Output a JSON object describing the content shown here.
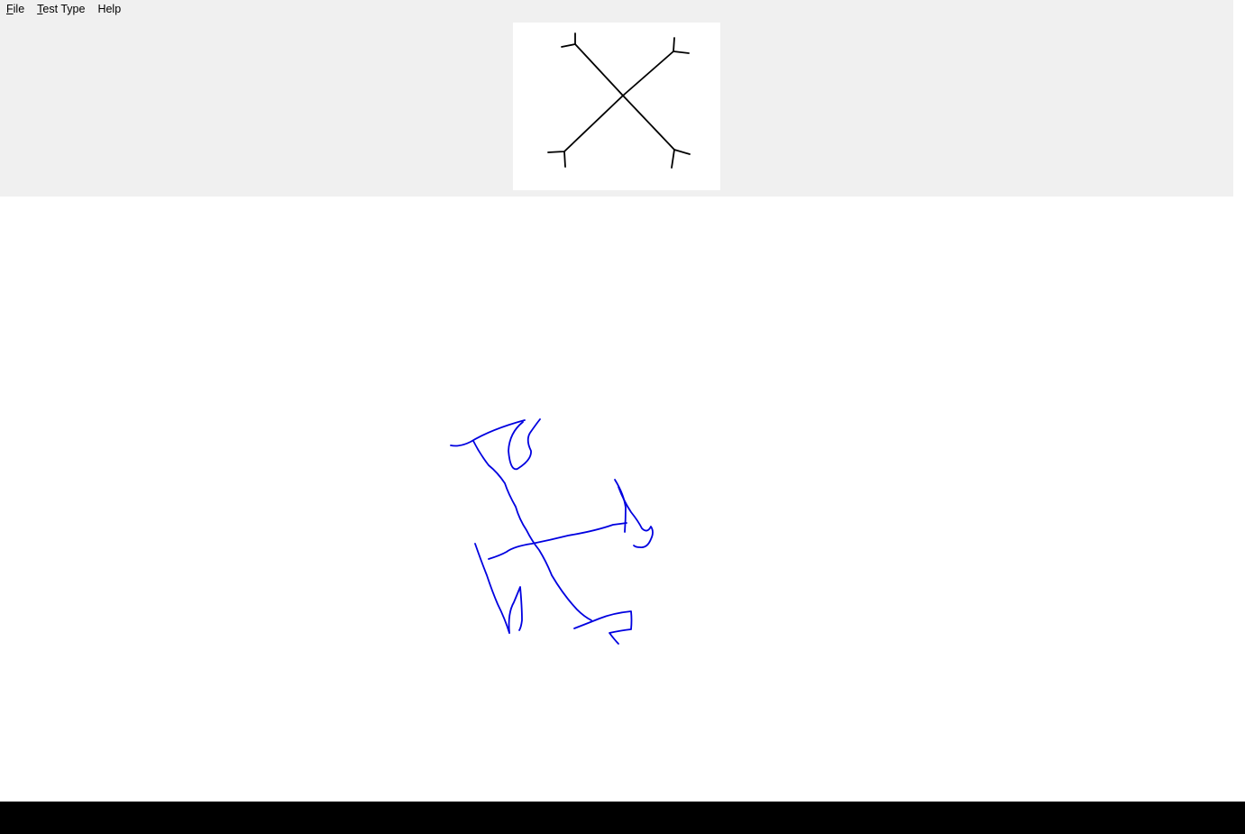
{
  "menubar": {
    "items": [
      {
        "label": "File",
        "mnemonic": "F",
        "rest": "ile"
      },
      {
        "label": "Test Type",
        "mnemonic": "T",
        "rest": "est Type"
      },
      {
        "label": "Help",
        "mnemonic": "",
        "rest": "Help"
      }
    ]
  },
  "reference_figure": {
    "description_icon": "x-cross-reference-icon",
    "stroke_color": "#000000"
  },
  "drawing": {
    "ink_color": "#0000e0"
  },
  "colors": {
    "window_bg": "#f0f0f0",
    "canvas_bg": "#ffffff",
    "taskbar_bg": "#000000"
  }
}
